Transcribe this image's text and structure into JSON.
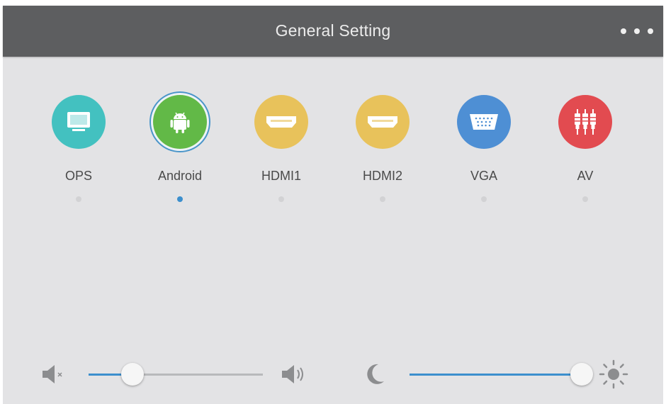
{
  "header": {
    "title": "General Setting",
    "menu_icon": "more-dots-icon"
  },
  "sources": [
    {
      "label": "OPS",
      "icon": "monitor-icon",
      "color": "#43c1c0",
      "selected": false
    },
    {
      "label": "Android",
      "icon": "android-icon",
      "color": "#62b947",
      "selected": true
    },
    {
      "label": "HDMI1",
      "icon": "hdmi-port-icon",
      "color": "#e8c25b",
      "selected": false
    },
    {
      "label": "HDMI2",
      "icon": "hdmi-port-icon",
      "color": "#e8c25b",
      "selected": false
    },
    {
      "label": "VGA",
      "icon": "vga-port-icon",
      "color": "#4e8fd4",
      "selected": false
    },
    {
      "label": "AV",
      "icon": "av-rca-icon",
      "color": "#e24b50",
      "selected": false
    }
  ],
  "volume": {
    "level": 0.25,
    "min_icon": "mute-icon",
    "max_icon": "volume-up-icon"
  },
  "brightness": {
    "level": 0.98,
    "min_icon": "moon-icon",
    "max_icon": "sun-icon"
  },
  "colors": {
    "header": "#5d5e60",
    "background": "#e3e3e5",
    "accent": "#3c8fcd"
  }
}
